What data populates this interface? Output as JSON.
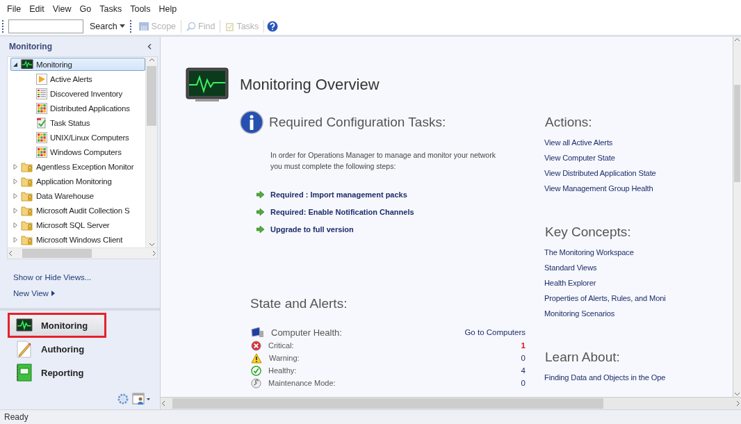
{
  "menu": [
    "File",
    "Edit",
    "View",
    "Go",
    "Tasks",
    "Tools",
    "Help"
  ],
  "toolbar": {
    "search_button": "Search",
    "tools": [
      {
        "kind": "scope",
        "label": "Scope",
        "disabled": true
      },
      {
        "kind": "find",
        "label": "Find",
        "disabled": true
      },
      {
        "kind": "tasks",
        "label": "Tasks",
        "disabled": true
      }
    ]
  },
  "navigation": {
    "title": "Monitoring",
    "tree": [
      {
        "kind": "monitor",
        "label": "Monitoring",
        "expanded": true,
        "selected": true,
        "children": [
          {
            "kind": "alert",
            "label": "Active Alerts",
            "selected": false
          },
          {
            "kind": "inventory",
            "label": "Discovered Inventory",
            "selected": false
          },
          {
            "kind": "state",
            "label": "Distributed Applications",
            "selected": false
          },
          {
            "kind": "task",
            "label": "Task Status",
            "selected": false
          },
          {
            "kind": "state",
            "label": "UNIX/Linux Computers",
            "selected": false
          },
          {
            "kind": "state",
            "label": "Windows Computers",
            "selected": false
          }
        ]
      },
      {
        "kind": "folder",
        "label": "Agentless Exception Monitor",
        "expanded": false,
        "selected": false
      },
      {
        "kind": "folder",
        "label": "Application Monitoring",
        "expanded": false,
        "selected": false
      },
      {
        "kind": "folder",
        "label": "Data Warehouse",
        "expanded": false,
        "selected": false
      },
      {
        "kind": "folder",
        "label": "Microsoft Audit Collection S",
        "expanded": false,
        "selected": false
      },
      {
        "kind": "folder",
        "label": "Microsoft SQL Server",
        "expanded": false,
        "selected": false
      },
      {
        "kind": "folder",
        "label": "Microsoft Windows Client",
        "expanded": false,
        "selected": false
      }
    ],
    "links": [
      {
        "label": "Show or Hide Views...",
        "submenu": false
      },
      {
        "label": "New View",
        "submenu": true
      }
    ],
    "workspaces": [
      {
        "kind": "monitoring",
        "label": "Monitoring",
        "selected": true,
        "annotated": true
      },
      {
        "kind": "authoring",
        "label": "Authoring",
        "selected": false,
        "annotated": false
      },
      {
        "kind": "reporting",
        "label": "Reporting",
        "selected": false,
        "annotated": false
      }
    ]
  },
  "overview": {
    "title": "Monitoring Overview",
    "configuration": {
      "heading": "Required Configuration Tasks:",
      "text": "In order for Operations Manager to manage and monitor your network you must complete the following steps:",
      "tasks": [
        "Required : Import management packs",
        "Required: Enable Notification Channels",
        "Upgrade to full version"
      ]
    },
    "state": {
      "heading": "State and Alerts:",
      "group": "Computer Health:",
      "group_link": "Go to Computers",
      "rows": [
        {
          "kind": "critical",
          "label": "Critical:",
          "count": "1"
        },
        {
          "kind": "warning",
          "label": "Warning:",
          "count": "0"
        },
        {
          "kind": "healthy",
          "label": "Healthy:",
          "count": "4"
        },
        {
          "kind": "maintenance",
          "label": "Maintenance Mode:",
          "count": "0"
        }
      ]
    },
    "sections": [
      {
        "heading": "Actions:",
        "links": [
          "View all Active Alerts",
          "View Computer State",
          "View Distributed Application State",
          "View Management Group Health"
        ]
      },
      {
        "heading": "Key Concepts:",
        "links": [
          "The Monitoring Workspace",
          "Standard Views",
          "Health Explorer",
          "Properties of Alerts, Rules, and Moni",
          "Monitoring Scenarios"
        ]
      },
      {
        "heading": "Learn About:",
        "links": [
          "Finding Data and Objects in the Ope"
        ]
      }
    ]
  },
  "status_bar": "Ready"
}
